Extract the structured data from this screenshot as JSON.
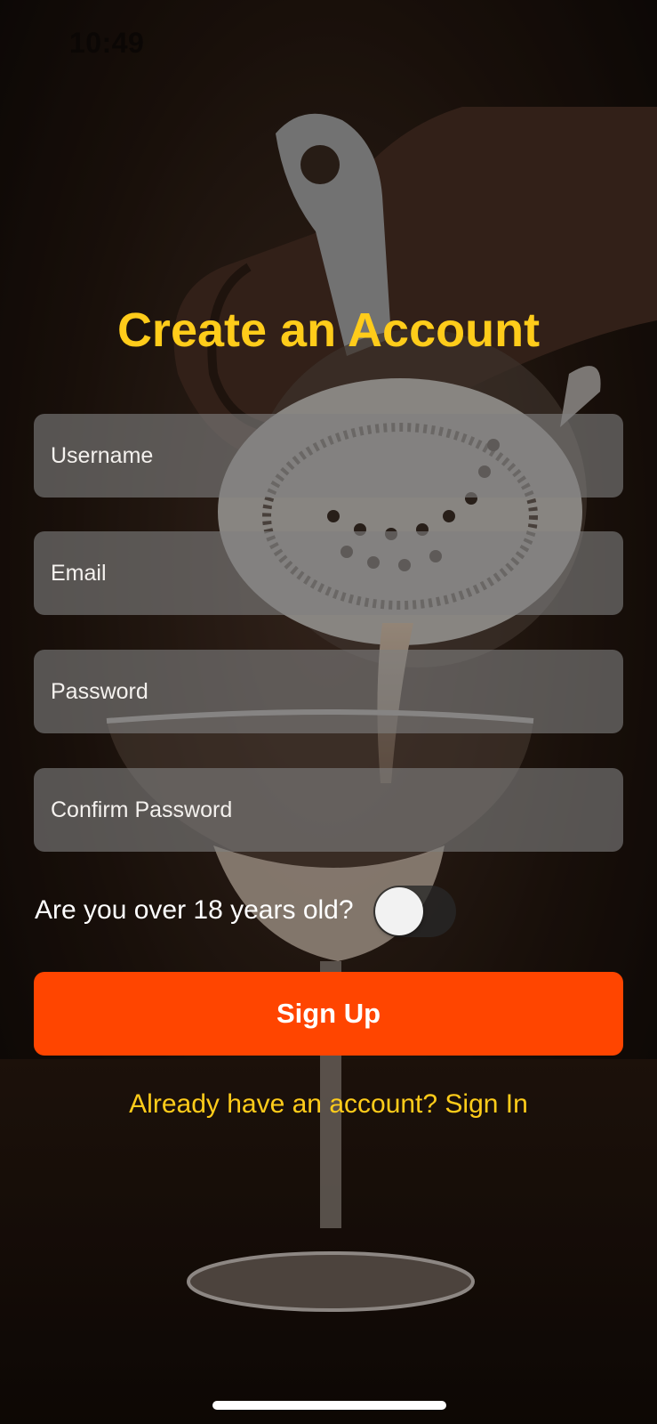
{
  "status_bar": {
    "time": "10:49"
  },
  "form": {
    "title": "Create an Account",
    "fields": [
      {
        "name": "username",
        "value": "",
        "placeholder": "Username"
      },
      {
        "name": "email",
        "value": "",
        "placeholder": "Email"
      },
      {
        "name": "password",
        "value": "",
        "placeholder": "Password"
      },
      {
        "name": "confirm_password",
        "value": "",
        "placeholder": "Confirm Password"
      }
    ],
    "age_question": "Are you over 18 years old?",
    "age_toggle_on": false,
    "submit_label": "Sign Up",
    "signin_link": "Already have an account? Sign In"
  },
  "colors": {
    "accent_yellow": "#ffcc1a",
    "button_orange": "#ff4500",
    "field_background": "#808080",
    "toggle_off_track": "#282828",
    "toggle_knob": "#f2f2f2"
  },
  "icons": {
    "background": "cocktail-strainer-photo",
    "toggle": "toggle-switch-off"
  }
}
